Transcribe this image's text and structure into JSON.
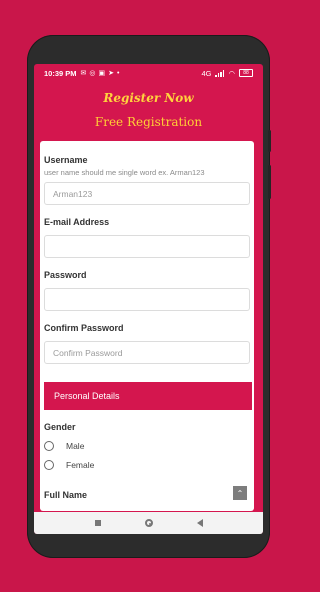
{
  "status": {
    "time": "10:39 PM",
    "left_icons": [
      "message-icon",
      "whatsapp-icon",
      "gallery-icon",
      "telegram-icon",
      "more-icon"
    ],
    "right_text": "4G",
    "battery": "88"
  },
  "header": {
    "title_script": "Register Now",
    "title_sub": "Free Registration"
  },
  "form": {
    "username": {
      "label": "Username",
      "hint": "user name should me single word ex. Arman123",
      "placeholder": "Arman123"
    },
    "email": {
      "label": "E-mail Address",
      "placeholder": ""
    },
    "password": {
      "label": "Password",
      "placeholder": ""
    },
    "confirm_password": {
      "label": "Confirm Password",
      "placeholder": "Confirm Password"
    },
    "section_personal": "Personal Details",
    "gender": {
      "label": "Gender",
      "options": [
        "Male",
        "Female"
      ]
    },
    "full_name": {
      "label": "Full Name"
    }
  },
  "colors": {
    "accent": "#d4164e",
    "background": "#c9164a",
    "header_text": "#ffd33d"
  }
}
